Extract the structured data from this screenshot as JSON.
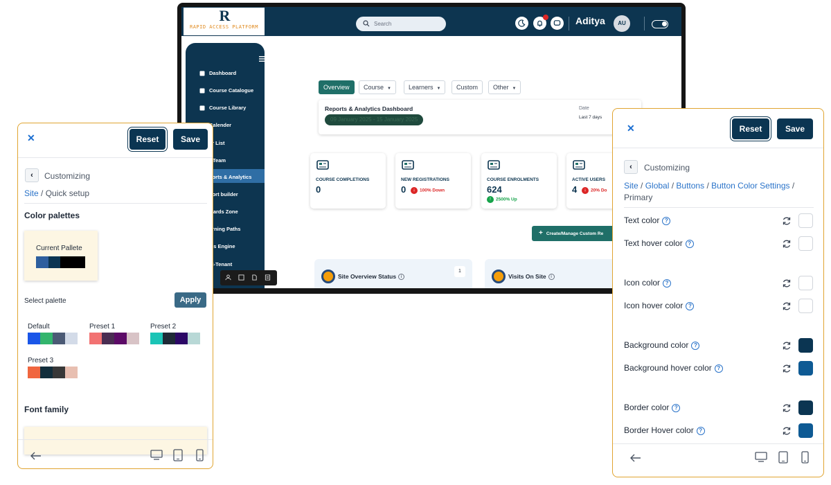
{
  "app": {
    "logo_mark": "R",
    "logo_text": "RAPID ACCESS PLATFORM",
    "search_placeholder": "Search",
    "user_name": "Aditya",
    "avatar_initials": "AU"
  },
  "sidebar": {
    "items": [
      {
        "label": "Dashboard",
        "icon": "gauge-icon"
      },
      {
        "label": "Course Catalogue",
        "icon": "book-icon"
      },
      {
        "label": "Course Library",
        "icon": "book-icon"
      },
      {
        "label": "Calender",
        "icon": "calendar-icon"
      },
      {
        "label": "er List",
        "icon": "list-icon"
      },
      {
        "label": "r Team",
        "icon": "team-icon"
      },
      {
        "label": "ports & Analytics",
        "icon": "chart-icon"
      },
      {
        "label": "port builder",
        "icon": "builder-icon"
      },
      {
        "label": "wards Zone",
        "icon": "award-icon"
      },
      {
        "label": "arning Paths",
        "icon": "path-icon"
      },
      {
        "label": "les Engine",
        "icon": "engine-icon"
      },
      {
        "label": "lti-Tenant",
        "icon": "tenant-icon"
      }
    ]
  },
  "dashboard": {
    "tabs": [
      {
        "label": "Overview",
        "dropdown": false,
        "active": true
      },
      {
        "label": "Course",
        "dropdown": true,
        "active": false
      },
      {
        "label": "Learners",
        "dropdown": true,
        "active": false
      },
      {
        "label": "Custom",
        "dropdown": false,
        "active": false
      },
      {
        "label": "Other",
        "dropdown": true,
        "active": false
      }
    ],
    "report_title": "Reports & Analytics Dashboard",
    "report_date_range": "09 January 2025 - 15 January 2025",
    "date_label": "Date",
    "date_value": "Last 7 days",
    "stats": [
      {
        "label": "COURSE COMPLETIONS",
        "value": "0",
        "change": "",
        "direction": "none"
      },
      {
        "label": "NEW REGISTRATIONS",
        "value": "0",
        "change": "100% Down",
        "direction": "down"
      },
      {
        "label": "COURSE ENROLMENTS",
        "value": "624",
        "change": "2500% Up",
        "direction": "up"
      },
      {
        "label": "ACTIVE USERS",
        "value": "4",
        "change": "20% Do",
        "direction": "down"
      }
    ],
    "create_button": "Create/Manage Custom Re",
    "cards": [
      {
        "title": "Site Overview Status",
        "badge": "1"
      },
      {
        "title": "Visits On Site",
        "badge": ""
      }
    ],
    "colors": {
      "navy": "#0d3550",
      "teal": "#1f6f68",
      "down": "#dc2626",
      "up": "#16a34a"
    }
  },
  "left_panel": {
    "reset_label": "Reset",
    "save_label": "Save",
    "title": "Customizing",
    "crumb_link": "Site",
    "crumb_rest": " / Quick setup",
    "palettes_heading": "Color palettes",
    "current_label": "Current Pallete",
    "current_colors": [
      "#2e5f9e",
      "#0b3552",
      "#000000"
    ],
    "select_label": "Select palette",
    "apply_label": "Apply",
    "presets": [
      {
        "name": "Default",
        "colors": [
          "#1a56e8",
          "#33b56d",
          "#4b5a75",
          "#d3dbe8"
        ]
      },
      {
        "name": "Preset 1",
        "colors": [
          "#f27272",
          "#4a2d52",
          "#5c0b67",
          "#d8c3c6"
        ]
      },
      {
        "name": "Preset 2",
        "colors": [
          "#1bc4b6",
          "#1f2a37",
          "#2c0866",
          "#b8d8d6"
        ]
      },
      {
        "name": "Preset 3",
        "colors": [
          "#f0663f",
          "#122e3c",
          "#383838",
          "#e8bfb1"
        ]
      }
    ],
    "font_heading": "Font family"
  },
  "right_panel": {
    "reset_label": "Reset",
    "save_label": "Save",
    "title": "Customizing",
    "crumbs": [
      "Site",
      "Global",
      "Buttons",
      "Button Color Settings"
    ],
    "crumb_current": "Primary",
    "properties": [
      {
        "label": "Text color",
        "color": "#ffffff"
      },
      {
        "label": "Text hover color",
        "color": "#ffffff"
      },
      {
        "label": "Icon color",
        "color": "#ffffff"
      },
      {
        "label": "Icon hover color",
        "color": "#ffffff"
      },
      {
        "label": "Background color",
        "color": "#0b3552"
      },
      {
        "label": "Background hover color",
        "color": "#0e5a94"
      },
      {
        "label": "Border color",
        "color": "#0b3552"
      },
      {
        "label": "Border Hover color",
        "color": "#0e5a94"
      }
    ]
  }
}
